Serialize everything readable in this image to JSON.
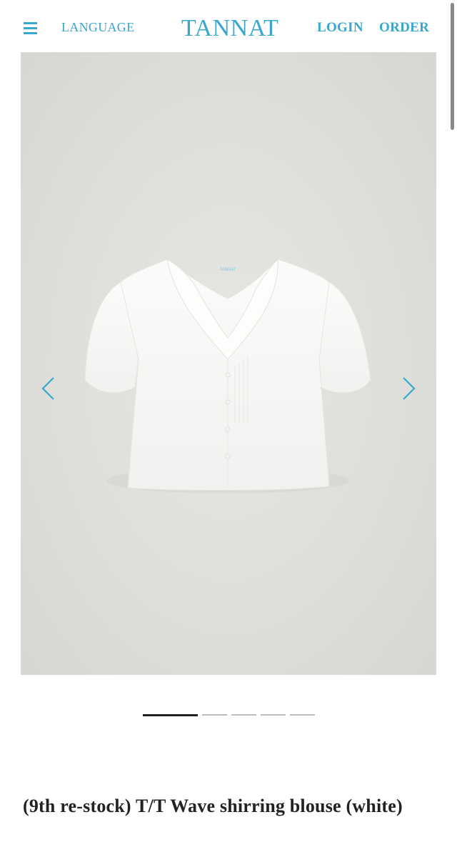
{
  "header": {
    "menu_icon": "hamburger-menu-icon",
    "language_label": "LANGUAGE",
    "logo_text": "TANNAT",
    "login_label": "LOGIN",
    "order_label": "ORDER",
    "accent_color": "#3aa7cf"
  },
  "gallery": {
    "image_label": "TANNAT",
    "prev_icon": "chevron-left-icon",
    "next_icon": "chevron-right-icon",
    "slide_count": 5,
    "active_slide": 1
  },
  "product": {
    "title": "(9th re-stock) T/T Wave shirring blouse (white)"
  }
}
